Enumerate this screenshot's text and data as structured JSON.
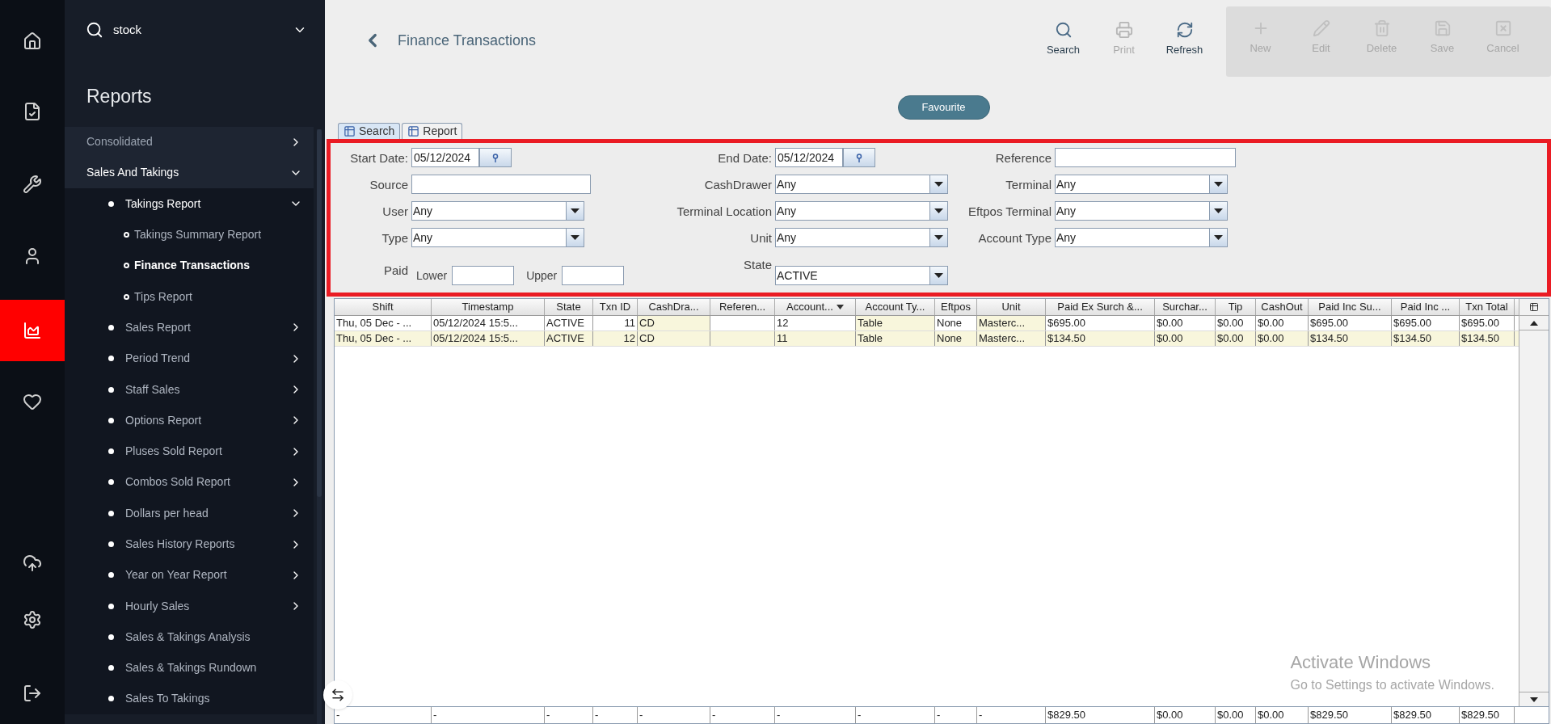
{
  "rail": {
    "items": [
      {
        "selected": false
      },
      {
        "selected": false
      },
      {
        "selected": false
      },
      {
        "selected": false
      },
      {
        "selected": true
      },
      {
        "selected": false
      },
      {
        "selected": false
      },
      {
        "selected": false
      },
      {
        "selected": false
      }
    ]
  },
  "sidebar": {
    "search": {
      "value": "stock"
    },
    "heading": "Reports",
    "items": [
      {
        "label": "Consolidated",
        "expanded": false,
        "selected": false
      },
      {
        "label": "Sales And Takings",
        "expanded": true,
        "selected": false,
        "children": [
          {
            "label": "Takings Report",
            "expanded": true,
            "selected": false,
            "children": [
              {
                "label": "Takings Summary Report",
                "selected": false
              },
              {
                "label": "Finance Transactions",
                "selected": true
              },
              {
                "label": "Tips Report",
                "selected": false
              }
            ]
          },
          {
            "label": "Sales Report",
            "expanded": false,
            "selected": false
          },
          {
            "label": "Period Trend",
            "expanded": false,
            "selected": false
          },
          {
            "label": "Staff Sales",
            "expanded": false,
            "selected": false
          },
          {
            "label": "Options Report",
            "expanded": false,
            "selected": false
          },
          {
            "label": "Pluses Sold Report",
            "expanded": false,
            "selected": false
          },
          {
            "label": "Combos Sold Report",
            "expanded": false,
            "selected": false
          },
          {
            "label": "Dollars per head",
            "expanded": false,
            "selected": false
          },
          {
            "label": "Sales History Reports",
            "expanded": false,
            "selected": false
          },
          {
            "label": "Year on Year Report",
            "expanded": false,
            "selected": false
          },
          {
            "label": "Hourly Sales",
            "expanded": false,
            "selected": false
          },
          {
            "label": "Sales & Takings Analysis",
            "selected": false
          },
          {
            "label": "Sales & Takings Rundown",
            "selected": false
          },
          {
            "label": "Sales To Takings",
            "selected": false
          }
        ]
      }
    ]
  },
  "header": {
    "title": "Finance Transactions",
    "toolbar": [
      {
        "label": "Search",
        "disabled": false
      },
      {
        "label": "Print",
        "disabled": true
      },
      {
        "label": "Refresh",
        "disabled": false
      }
    ],
    "edit_toolbar": [
      {
        "label": "New",
        "disabled": true
      },
      {
        "label": "Edit",
        "disabled": true
      },
      {
        "label": "Delete",
        "disabled": true
      },
      {
        "label": "Save",
        "disabled": true
      },
      {
        "label": "Cancel",
        "disabled": true
      }
    ]
  },
  "favourite": "Favourite",
  "tabs": [
    {
      "label": "Search",
      "selected": true
    },
    {
      "label": "Report",
      "selected": false
    }
  ],
  "filters": {
    "columns": [
      [
        {
          "kind": "date",
          "label": "Start Date:",
          "value": "05/12/2024"
        },
        {
          "kind": "text",
          "label": "Source"
        },
        {
          "kind": "select",
          "label": "User",
          "value": "Any"
        },
        {
          "kind": "select",
          "label": "Type",
          "value": "Any"
        },
        {
          "kind": "range",
          "label": "Paid",
          "lower_label": "Lower",
          "upper_label": "Upper"
        }
      ],
      [
        {
          "kind": "date",
          "label": "End Date:",
          "value": "05/12/2024"
        },
        {
          "kind": "select",
          "label": "CashDrawer",
          "value": "Any"
        },
        {
          "kind": "select",
          "label": "Terminal Location",
          "value": "Any"
        },
        {
          "kind": "select",
          "label": "Unit",
          "value": "Any"
        },
        {
          "kind": "select",
          "label": "State",
          "value": "ACTIVE"
        }
      ],
      [
        {
          "kind": "text",
          "label": "Reference"
        },
        {
          "kind": "select",
          "label": "Terminal",
          "value": "Any"
        },
        {
          "kind": "select",
          "label": "Eftpos Terminal",
          "value": "Any"
        },
        {
          "kind": "select",
          "label": "Account Type",
          "value": "Any"
        }
      ]
    ]
  },
  "table": {
    "columns": [
      {
        "label": "Shift",
        "highlighted": false,
        "sorted": false
      },
      {
        "label": "Timestamp",
        "highlighted": false,
        "sorted": false
      },
      {
        "label": "State",
        "highlighted": false,
        "sorted": false
      },
      {
        "label": "Txn ID",
        "highlighted": false,
        "sorted": false
      },
      {
        "label": "CashDra...",
        "highlighted": true,
        "sorted": false
      },
      {
        "label": "Referen...",
        "highlighted": false,
        "sorted": false
      },
      {
        "label": "Account...",
        "highlighted": false,
        "sorted": true
      },
      {
        "label": "Account Ty...",
        "highlighted": true,
        "sorted": false
      },
      {
        "label": "Eftpos",
        "highlighted": false,
        "sorted": false
      },
      {
        "label": "Unit",
        "highlighted": true,
        "sorted": false
      },
      {
        "label": "Paid Ex Surch &...",
        "highlighted": false,
        "sorted": false
      },
      {
        "label": "Surchar...",
        "highlighted": false,
        "sorted": false
      },
      {
        "label": "Tip",
        "highlighted": false,
        "sorted": false
      },
      {
        "label": "CashOut",
        "highlighted": false,
        "sorted": false
      },
      {
        "label": "Paid Inc Su...",
        "highlighted": false,
        "sorted": false
      },
      {
        "label": "Paid Inc ...",
        "highlighted": false,
        "sorted": false
      },
      {
        "label": "Txn Total",
        "highlighted": false,
        "sorted": false
      }
    ],
    "rows": [
      [
        "Thu, 05 Dec - ...",
        "05/12/2024 15:5...",
        "ACTIVE",
        "11",
        "CD",
        "",
        "12",
        "Table",
        "None",
        "Masterc...",
        "$695.00",
        "$0.00",
        "$0.00",
        "$0.00",
        "$695.00",
        "$695.00",
        "$695.00"
      ],
      [
        "Thu, 05 Dec - ...",
        "05/12/2024 15:5...",
        "ACTIVE",
        "12",
        "CD",
        "",
        "11",
        "Table",
        "None",
        "Masterc...",
        "$134.50",
        "$0.00",
        "$0.00",
        "$0.00",
        "$134.50",
        "$134.50",
        "$134.50"
      ]
    ],
    "totals": [
      "-",
      "-",
      "-",
      "-",
      "-",
      "-",
      "-",
      "-",
      "-",
      "-",
      "$829.50",
      "$0.00",
      "$0.00",
      "$0.00",
      "$829.50",
      "$829.50",
      "$829.50"
    ]
  },
  "os_notice": {
    "title": "Activate Windows",
    "message": "Go to Settings to activate Windows."
  }
}
